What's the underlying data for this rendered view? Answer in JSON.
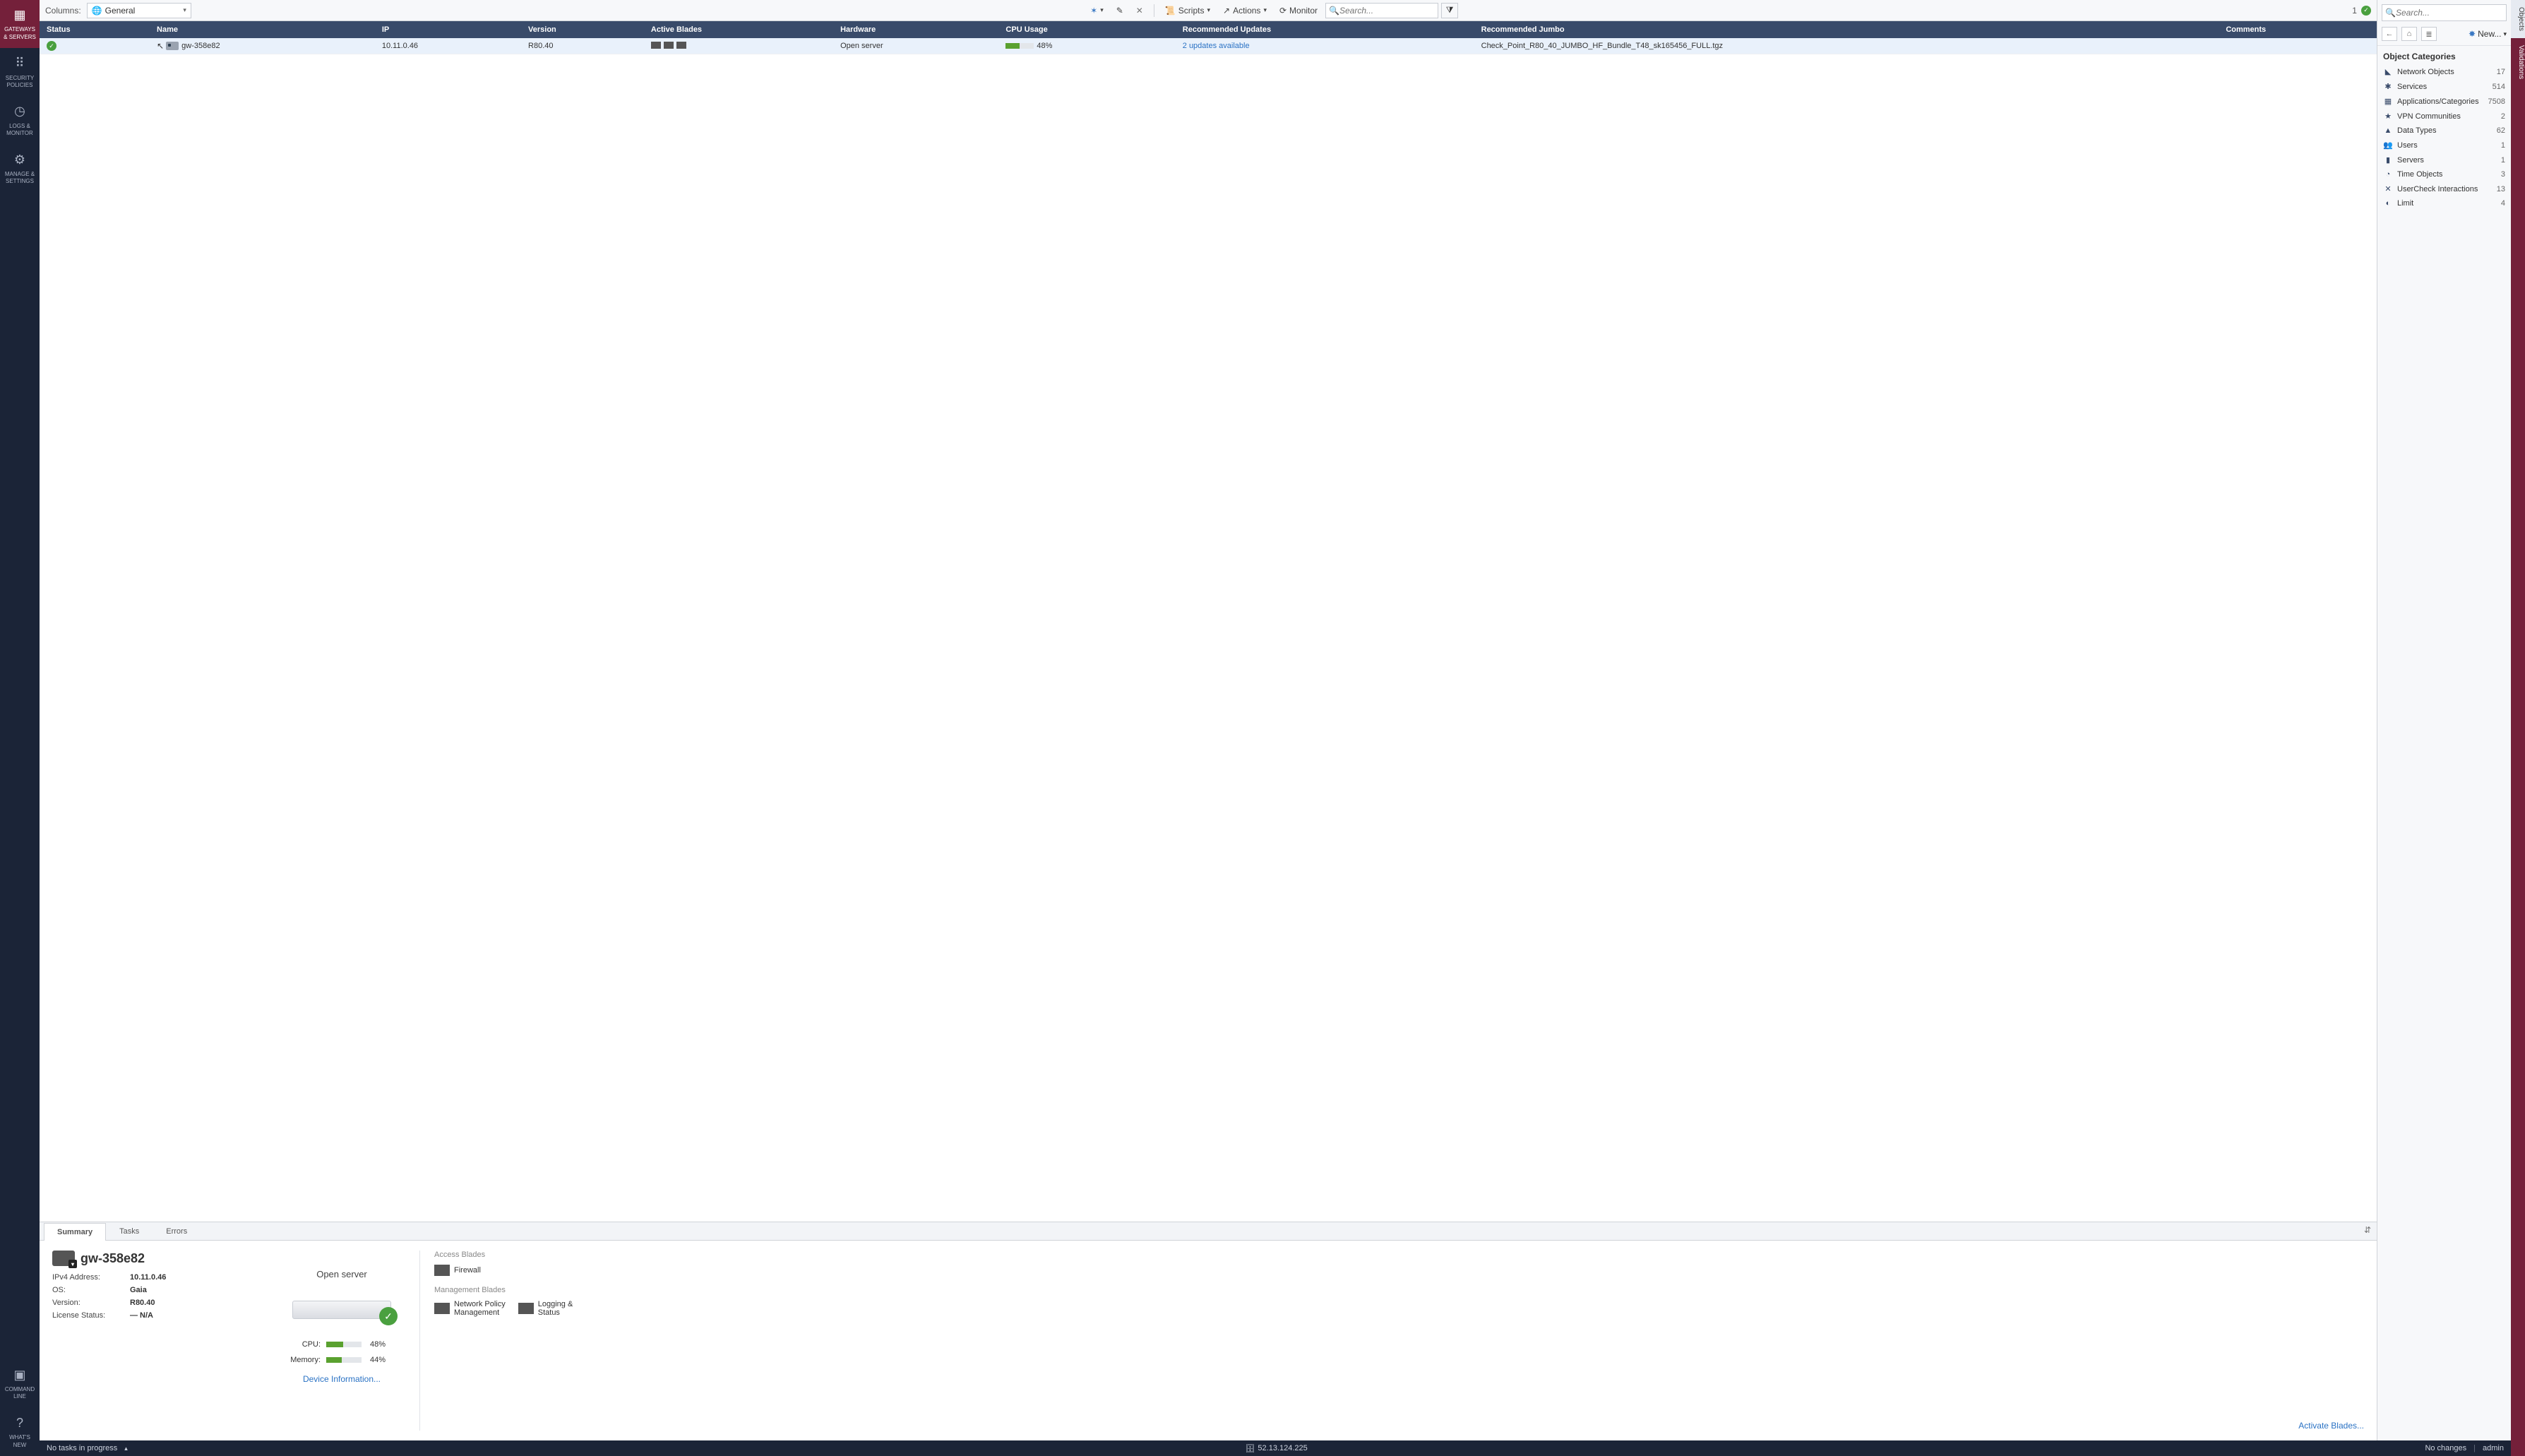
{
  "leftnav": {
    "items": [
      {
        "id": "gateways",
        "l1": "GATEWAYS",
        "l2": "& SERVERS"
      },
      {
        "id": "policies",
        "l1": "SECURITY",
        "l2": "POLICIES"
      },
      {
        "id": "logs",
        "l1": "LOGS &",
        "l2": "MONITOR"
      },
      {
        "id": "manage",
        "l1": "MANAGE &",
        "l2": "SETTINGS"
      }
    ],
    "bottom": [
      {
        "id": "cmdline",
        "l1": "COMMAND",
        "l2": "LINE"
      },
      {
        "id": "whatsnew",
        "l1": "WHAT'S",
        "l2": "NEW"
      }
    ]
  },
  "rightnav": {
    "objects": "Objects",
    "validations": "Validations"
  },
  "toolbar": {
    "columns_label": "Columns:",
    "columns_value": "General",
    "scripts": "Scripts",
    "actions": "Actions",
    "monitor": "Monitor",
    "search_ph": "Search...",
    "count": "1"
  },
  "tableHeaders": [
    "Status",
    "Name",
    "IP",
    "Version",
    "Active Blades",
    "Hardware",
    "CPU Usage",
    "Recommended Updates",
    "Recommended Jumbo",
    "Comments"
  ],
  "rows": [
    {
      "status": "ok",
      "name": "gw-358e82",
      "ip": "10.11.0.46",
      "version": "R80.40",
      "hardware": "Open server",
      "cpu_pct": 48,
      "updates": "2 updates available",
      "jumbo": "Check_Point_R80_40_JUMBO_HF_Bundle_T48_sk165456_FULL.tgz",
      "comments": ""
    }
  ],
  "details": {
    "tabs": [
      "Summary",
      "Tasks",
      "Errors"
    ],
    "name": "gw-358e82",
    "kv": [
      {
        "k": "IPv4 Address:",
        "v": "10.11.0.46"
      },
      {
        "k": "OS:",
        "v": "Gaia"
      },
      {
        "k": "Version:",
        "v": "R80.40"
      },
      {
        "k": "License Status:",
        "v": "— N/A"
      }
    ],
    "hardware": "Open server",
    "metrics": {
      "cpu_label": "CPU:",
      "cpu_pct": 48,
      "mem_label": "Memory:",
      "mem_pct": 44
    },
    "access_blades_title": "Access Blades",
    "access_blades": [
      {
        "name": "Firewall"
      }
    ],
    "mgmt_blades_title": "Management Blades",
    "mgmt_blades": [
      {
        "name": "Network Policy Management"
      },
      {
        "name": "Logging & Status"
      }
    ],
    "device_info_link": "Device Information...",
    "activate_link": "Activate Blades..."
  },
  "objects": {
    "search_ph": "Search...",
    "new_label": "New...",
    "title": "Object Categories",
    "cats": [
      {
        "name": "Network Objects",
        "count": 17,
        "glyph": "◣"
      },
      {
        "name": "Services",
        "count": 514,
        "glyph": "✱"
      },
      {
        "name": "Applications/Categories",
        "count": 7508,
        "glyph": "▦"
      },
      {
        "name": "VPN Communities",
        "count": 2,
        "glyph": "★"
      },
      {
        "name": "Data Types",
        "count": 62,
        "glyph": "▲"
      },
      {
        "name": "Users",
        "count": 1,
        "glyph": "👥"
      },
      {
        "name": "Servers",
        "count": 1,
        "glyph": "▮"
      },
      {
        "name": "Time Objects",
        "count": 3,
        "glyph": "◔"
      },
      {
        "name": "UserCheck Interactions",
        "count": 13,
        "glyph": "✕"
      },
      {
        "name": "Limit",
        "count": 4,
        "glyph": "◐"
      }
    ]
  },
  "statusbar": {
    "tasks": "No tasks in progress",
    "server": "52.13.124.225",
    "changes": "No changes",
    "user": "admin"
  }
}
